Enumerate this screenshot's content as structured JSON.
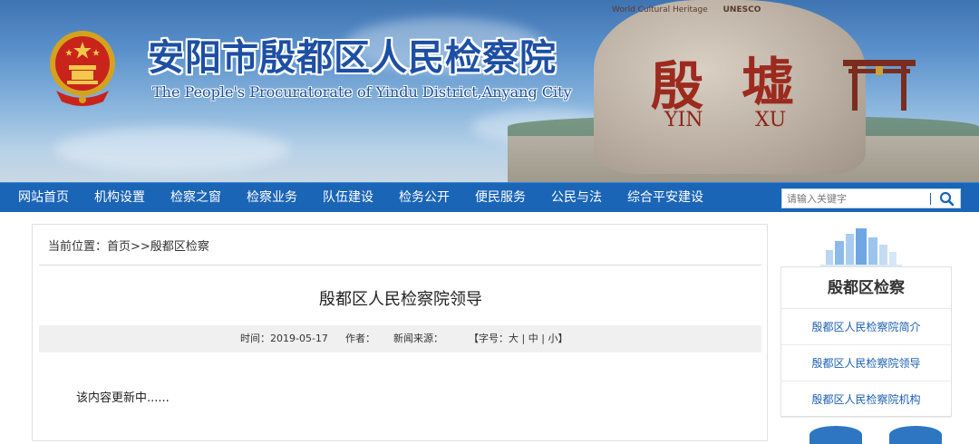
{
  "header": {
    "title": "安阳市殷都区人民检察院",
    "subtitle": "The People's Procuratorate of Yindu District,Anyang City",
    "stone_text_top": "World Cultural Heritage",
    "stone_unesco": "UNESCO",
    "stone_glyph_1": "殷",
    "stone_glyph_2": "墟",
    "stone_caption_1": "YIN",
    "stone_caption_2": "XU"
  },
  "nav": {
    "items": [
      {
        "label": "网站首页"
      },
      {
        "label": "机构设置"
      },
      {
        "label": "检察之窗"
      },
      {
        "label": "检察业务"
      },
      {
        "label": "队伍建设"
      },
      {
        "label": "检务公开"
      },
      {
        "label": "便民服务"
      },
      {
        "label": "公民与法"
      },
      {
        "label": "综合平安建设"
      }
    ],
    "search_placeholder": "请输入关键字",
    "search_icon": "search-icon",
    "bar_color": "#1b65b7"
  },
  "breadcrumb": {
    "prefix": "当前位置：",
    "home": "首页",
    "sep": ">>",
    "current": "殷都区检察"
  },
  "article": {
    "title": "殷都区人民检察院领导",
    "time_label": "时间：",
    "time_value": "2019-05-17",
    "author_label": "作者：",
    "source_label": "新闻来源：",
    "fontsize_open": "【字号：",
    "fontsize_large": "大",
    "fontsize_sep1": "|",
    "fontsize_medium": "中",
    "fontsize_sep2": "|",
    "fontsize_small": "小",
    "fontsize_close": "】",
    "body": "该内容更新中......"
  },
  "sidebar": {
    "title": "殷都区检察",
    "links": [
      {
        "label": "殷都区人民检察院简介"
      },
      {
        "label": "殷都区人民检察院领导"
      },
      {
        "label": "殷都区人民检察院机构"
      }
    ]
  }
}
